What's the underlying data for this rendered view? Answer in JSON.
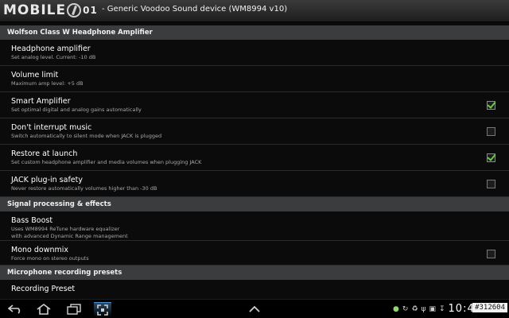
{
  "titlebar": {
    "logo_text": "MOBILE",
    "logo_suffix": "01",
    "title": "- Generic Voodoo Sound device (WM8994 v10)"
  },
  "sections": [
    {
      "header": "Wolfson Class W Headphone Amplifier",
      "items": [
        {
          "title": "Headphone amplifier",
          "subtitle": "Set analog level. Current: -10 dB",
          "checkbox": null
        },
        {
          "title": "Volume limit",
          "subtitle": "Maximum amp level: +5 dB",
          "checkbox": null
        },
        {
          "title": "Smart Amplifier",
          "subtitle": "Set optimal digital and analog gains automatically",
          "checkbox": true
        },
        {
          "title": "Don't interrupt music",
          "subtitle": "Switch automatically to silent mode when JACK is plugged",
          "checkbox": false
        },
        {
          "title": "Restore at launch",
          "subtitle": "Set custom headphone amplifier and media volumes when plugging JACK",
          "checkbox": true
        },
        {
          "title": "JACK plug-in safety",
          "subtitle": "Never restore automatically volumes higher than -30 dB",
          "checkbox": false
        }
      ]
    },
    {
      "header": "Signal processing & effects",
      "items": [
        {
          "title": "Bass Boost",
          "subtitle": "Uses WM8994 ReTune hardware equalizer\nwith advanced Dynamic Range management",
          "checkbox": null
        },
        {
          "title": "Mono downmix",
          "subtitle": "Force mono on stereo outputs",
          "checkbox": false
        }
      ]
    },
    {
      "header": "Microphone recording presets",
      "items": [
        {
          "title": "Recording Preset",
          "subtitle": "",
          "checkbox": null
        }
      ]
    }
  ],
  "navbar": {
    "icons": [
      "back-icon",
      "home-icon",
      "recent-apps-icon",
      "screenshot-icon",
      "up-arrow-icon"
    ],
    "status_icons": [
      "battery-percent-icon",
      "sync-icon",
      "recycle-icon",
      "usb-icon",
      "image-icon",
      "download-icon"
    ],
    "clock": "10:47"
  },
  "watermark": "#312604",
  "colors": {
    "check": "#6ac84a",
    "section_bg": "#3a3c3e",
    "background": "#0b0b0b"
  }
}
